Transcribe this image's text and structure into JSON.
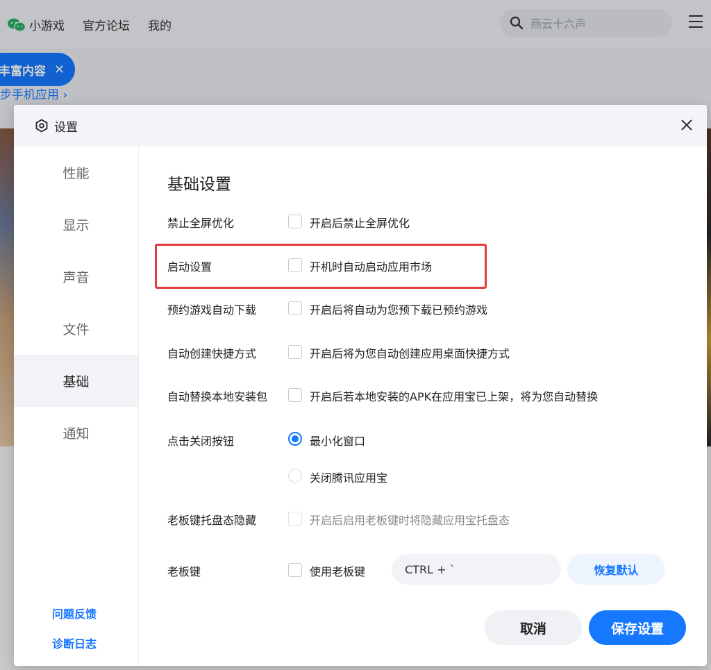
{
  "app": {
    "brand": "小游戏",
    "nav": [
      "官方论坛",
      "我的"
    ],
    "search_placeholder": "燕云十六声",
    "banner_pill": "丰富内容",
    "banner_pill_close": "✕",
    "banner_link": "步手机应用 ›"
  },
  "dialog": {
    "title": "设置",
    "sidebar": [
      "性能",
      "显示",
      "声音",
      "文件",
      "基础",
      "通知"
    ],
    "active_sidebar": "基础",
    "footer_links": [
      "问题反馈",
      "诊断日志"
    ],
    "section_title": "基础设置",
    "rows": [
      {
        "label": "禁止全屏优化",
        "option": "开启后禁止全屏优化",
        "checked": false
      },
      {
        "label": "启动设置",
        "option": "开机时自动启动应用市场",
        "checked": false
      },
      {
        "label": "预约游戏自动下载",
        "option": "开启后将自动为您预下载已预约游戏",
        "checked": false
      },
      {
        "label": "自动创建快捷方式",
        "option": "开启后将为您自动创建应用桌面快捷方式",
        "checked": false
      },
      {
        "label": "自动替换本地安装包",
        "option": "开启后若本地安装的APK在应用宝已上架，将为您自动替换",
        "checked": false
      }
    ],
    "close_button": {
      "label": "点击关闭按钮",
      "options": [
        "最小化窗口",
        "关闭腾讯应用宝"
      ],
      "selected": "最小化窗口"
    },
    "boss_hide": {
      "label": "老板键托盘态隐藏",
      "option": "开启后启用老板键时将隐藏应用宝托盘态",
      "checked": false,
      "disabled": true
    },
    "boss_key": {
      "label": "老板键",
      "option": "使用老板键",
      "checked": false,
      "hotkey": "CTRL + `",
      "restore_label": "恢复默认"
    },
    "cancel_label": "取消",
    "save_label": "保存设置"
  },
  "colors": {
    "accent": "#1677ff",
    "highlight": "#e23b3b"
  }
}
